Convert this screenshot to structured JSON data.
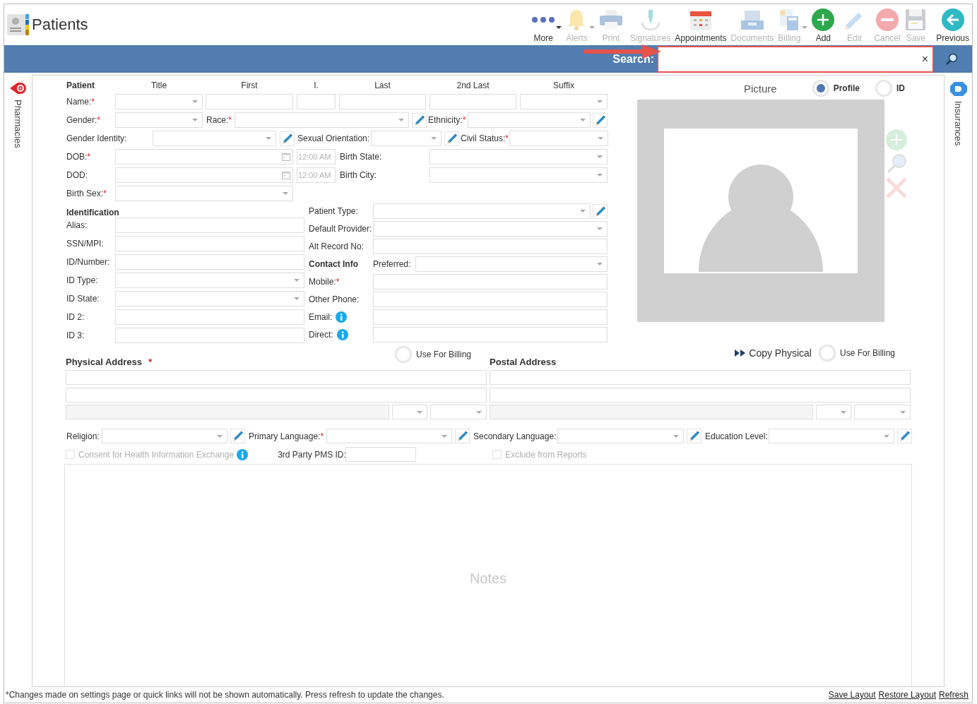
{
  "app": {
    "title": "Patients"
  },
  "toolbar": [
    {
      "label": "More",
      "disabled": false,
      "dropdown": true
    },
    {
      "label": "Alerts",
      "disabled": true,
      "dropdown": true
    },
    {
      "label": "Print",
      "disabled": true,
      "dropdown": false
    },
    {
      "label": "Signatures",
      "disabled": true,
      "dropdown": false
    },
    {
      "label": "Appointments",
      "disabled": false,
      "dropdown": false
    },
    {
      "label": "Documents",
      "disabled": true,
      "dropdown": false
    },
    {
      "label": "Billing",
      "disabled": true,
      "dropdown": true
    },
    {
      "label": "Add",
      "disabled": false,
      "dropdown": false
    },
    {
      "label": "Edit",
      "disabled": true,
      "dropdown": false
    },
    {
      "label": "Cancel",
      "disabled": true,
      "dropdown": false
    },
    {
      "label": "Save",
      "disabled": true,
      "dropdown": false
    },
    {
      "label": "Previous",
      "disabled": false,
      "dropdown": false
    }
  ],
  "search": {
    "label": "Search:",
    "clear": "×"
  },
  "side_tabs": {
    "left": "Pharmacies",
    "right": "Insurances"
  },
  "patient": {
    "heading": "Patient",
    "name": {
      "text": "Name:",
      "mark": "*"
    },
    "name_columns": [
      "Title",
      "First",
      "I.",
      "Last",
      "2nd Last",
      "Suffix"
    ],
    "gender": {
      "text": "Gender:",
      "mark": "*"
    },
    "race": {
      "text": "Race:",
      "mark": "*"
    },
    "ethnicity": {
      "text": "Ethnicity:",
      "mark": "*"
    },
    "gender_identity": {
      "text": "Gender Identity:"
    },
    "sexual_orientation": {
      "text": "Sexual Orientation:"
    },
    "civil_status": {
      "text": "Civil Status:",
      "mark": "*"
    },
    "dob": {
      "text": "DOB:",
      "mark": "*"
    },
    "dob_time": "12:00 AM",
    "birth_state": {
      "text": "Birth State:"
    },
    "dod": {
      "text": "DOD:"
    },
    "dod_time": "12:00 AM",
    "birth_city": {
      "text": "Birth City:"
    },
    "birth_sex": {
      "text": "Birth Sex:",
      "mark": "*"
    }
  },
  "identification": {
    "heading": "Identification",
    "fields": [
      {
        "label": {
          "text": "Alias:"
        },
        "kind": "text"
      },
      {
        "label": {
          "text": "SSN/MPI:"
        },
        "kind": "text"
      },
      {
        "label": {
          "text": "ID/Number:"
        },
        "kind": "text"
      },
      {
        "label": {
          "text": "ID Type:"
        },
        "kind": "select"
      },
      {
        "label": {
          "text": "ID State:"
        },
        "kind": "select"
      },
      {
        "label": {
          "text": "ID 2:"
        },
        "kind": "text"
      },
      {
        "label": {
          "text": "ID 3:"
        },
        "kind": "text"
      }
    ]
  },
  "details": {
    "patient_type": {
      "text": "Patient Type:"
    },
    "default_provider": {
      "text": "Default Provider:"
    },
    "alt_record": {
      "text": "Alt Record No:"
    }
  },
  "contact": {
    "heading": "Contact Info",
    "preferred": {
      "text": "Preferred:"
    },
    "fields": [
      {
        "label": {
          "text": "Mobile:",
          "mark": "*"
        },
        "kind": "plain"
      },
      {
        "label": {
          "text": "Other Phone:"
        },
        "kind": "plain"
      },
      {
        "label": {
          "text": "Email:"
        },
        "kind": "info"
      },
      {
        "label": {
          "text": "Direct:"
        },
        "kind": "info"
      }
    ]
  },
  "picture": {
    "label": "Picture",
    "options": [
      {
        "label": "Profile",
        "selected": true
      },
      {
        "label": "ID",
        "selected": false
      }
    ]
  },
  "physical_address": {
    "heading": "Physical Address",
    "mark": "*",
    "billing": {
      "label": "Use For Billing",
      "selected": false
    }
  },
  "postal_address": {
    "heading": "Postal Address",
    "copy": "Copy Physical",
    "billing": {
      "label": "Use For Billing",
      "selected": false
    }
  },
  "demographics": [
    {
      "label": {
        "text": "Religion:"
      }
    },
    {
      "label": {
        "text": "Primary Language:",
        "mark": "*"
      }
    },
    {
      "label": {
        "text": "Secondary Language:"
      }
    },
    {
      "label": {
        "text": "Education Level:"
      }
    }
  ],
  "consent": {
    "label": "Consent for Health Information Exchange",
    "checked": false,
    "disabled": true
  },
  "pms_id": {
    "label": "3rd Party PMS ID:"
  },
  "exclude": {
    "label": "Exclude from Reports",
    "checked": false,
    "disabled": true
  },
  "notes": {
    "placeholder": "Notes"
  },
  "footer": {
    "message": "*Changes made on settings page or quick links will not be shown automatically. Press refresh to update the changes.",
    "links": [
      "Save Layout",
      "Restore Layout",
      "Refresh"
    ]
  }
}
